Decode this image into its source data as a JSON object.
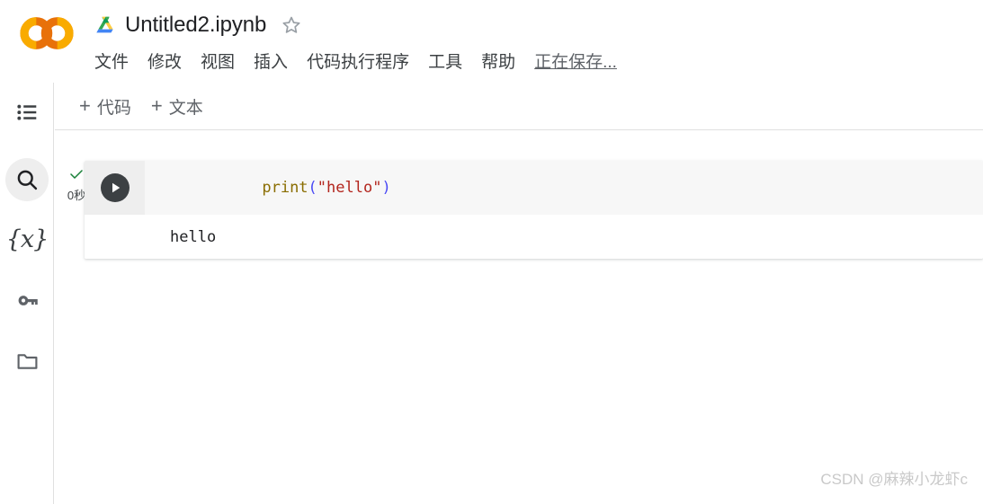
{
  "app": {
    "name": "Google Colab",
    "logo_icon": "colab-logo",
    "brand_colors": {
      "orange_light": "#F9AB00",
      "orange_dark": "#E8710A"
    }
  },
  "header": {
    "drive_icon": "google-drive-icon",
    "title": "Untitled2.ipynb",
    "star_icon": "star-outline-icon",
    "menu_items": [
      {
        "label": "文件",
        "name": "menu-file"
      },
      {
        "label": "修改",
        "name": "menu-edit"
      },
      {
        "label": "视图",
        "name": "menu-view"
      },
      {
        "label": "插入",
        "name": "menu-insert"
      },
      {
        "label": "代码执行程序",
        "name": "menu-runtime"
      },
      {
        "label": "工具",
        "name": "menu-tools"
      },
      {
        "label": "帮助",
        "name": "menu-help"
      }
    ],
    "save_status": "正在保存..."
  },
  "sidebar": {
    "items": [
      {
        "label": "目录",
        "icon": "table-of-contents-icon",
        "name": "sidebar-item-toc",
        "active": false
      },
      {
        "label": "查找和替换",
        "icon": "search-icon",
        "name": "sidebar-item-search",
        "active": true
      },
      {
        "label": "变量",
        "icon": "variables-icon",
        "name": "sidebar-item-variables",
        "active": false
      },
      {
        "label": "密钥",
        "icon": "key-icon",
        "name": "sidebar-item-secrets",
        "active": false
      },
      {
        "label": "文件",
        "icon": "folder-icon",
        "name": "sidebar-item-files",
        "active": false
      }
    ],
    "variables_glyph": "{x}"
  },
  "toolbar": {
    "add_code_label": "代码",
    "add_text_label": "文本",
    "plus_glyph": "+"
  },
  "notebook": {
    "cells": [
      {
        "type": "code",
        "status_icon": "check-icon",
        "status_color": "#188038",
        "execution_time": "0秒",
        "run_icon": "play-icon",
        "code_tokens": [
          {
            "text": "print",
            "kind": "function"
          },
          {
            "text": "(",
            "kind": "paren"
          },
          {
            "text": "\"hello\"",
            "kind": "string"
          },
          {
            "text": ")",
            "kind": "paren"
          }
        ],
        "code_plain": "print(\"hello\")",
        "output": "hello"
      }
    ]
  },
  "watermark": {
    "text": "CSDN @麻辣小龙虾c"
  }
}
